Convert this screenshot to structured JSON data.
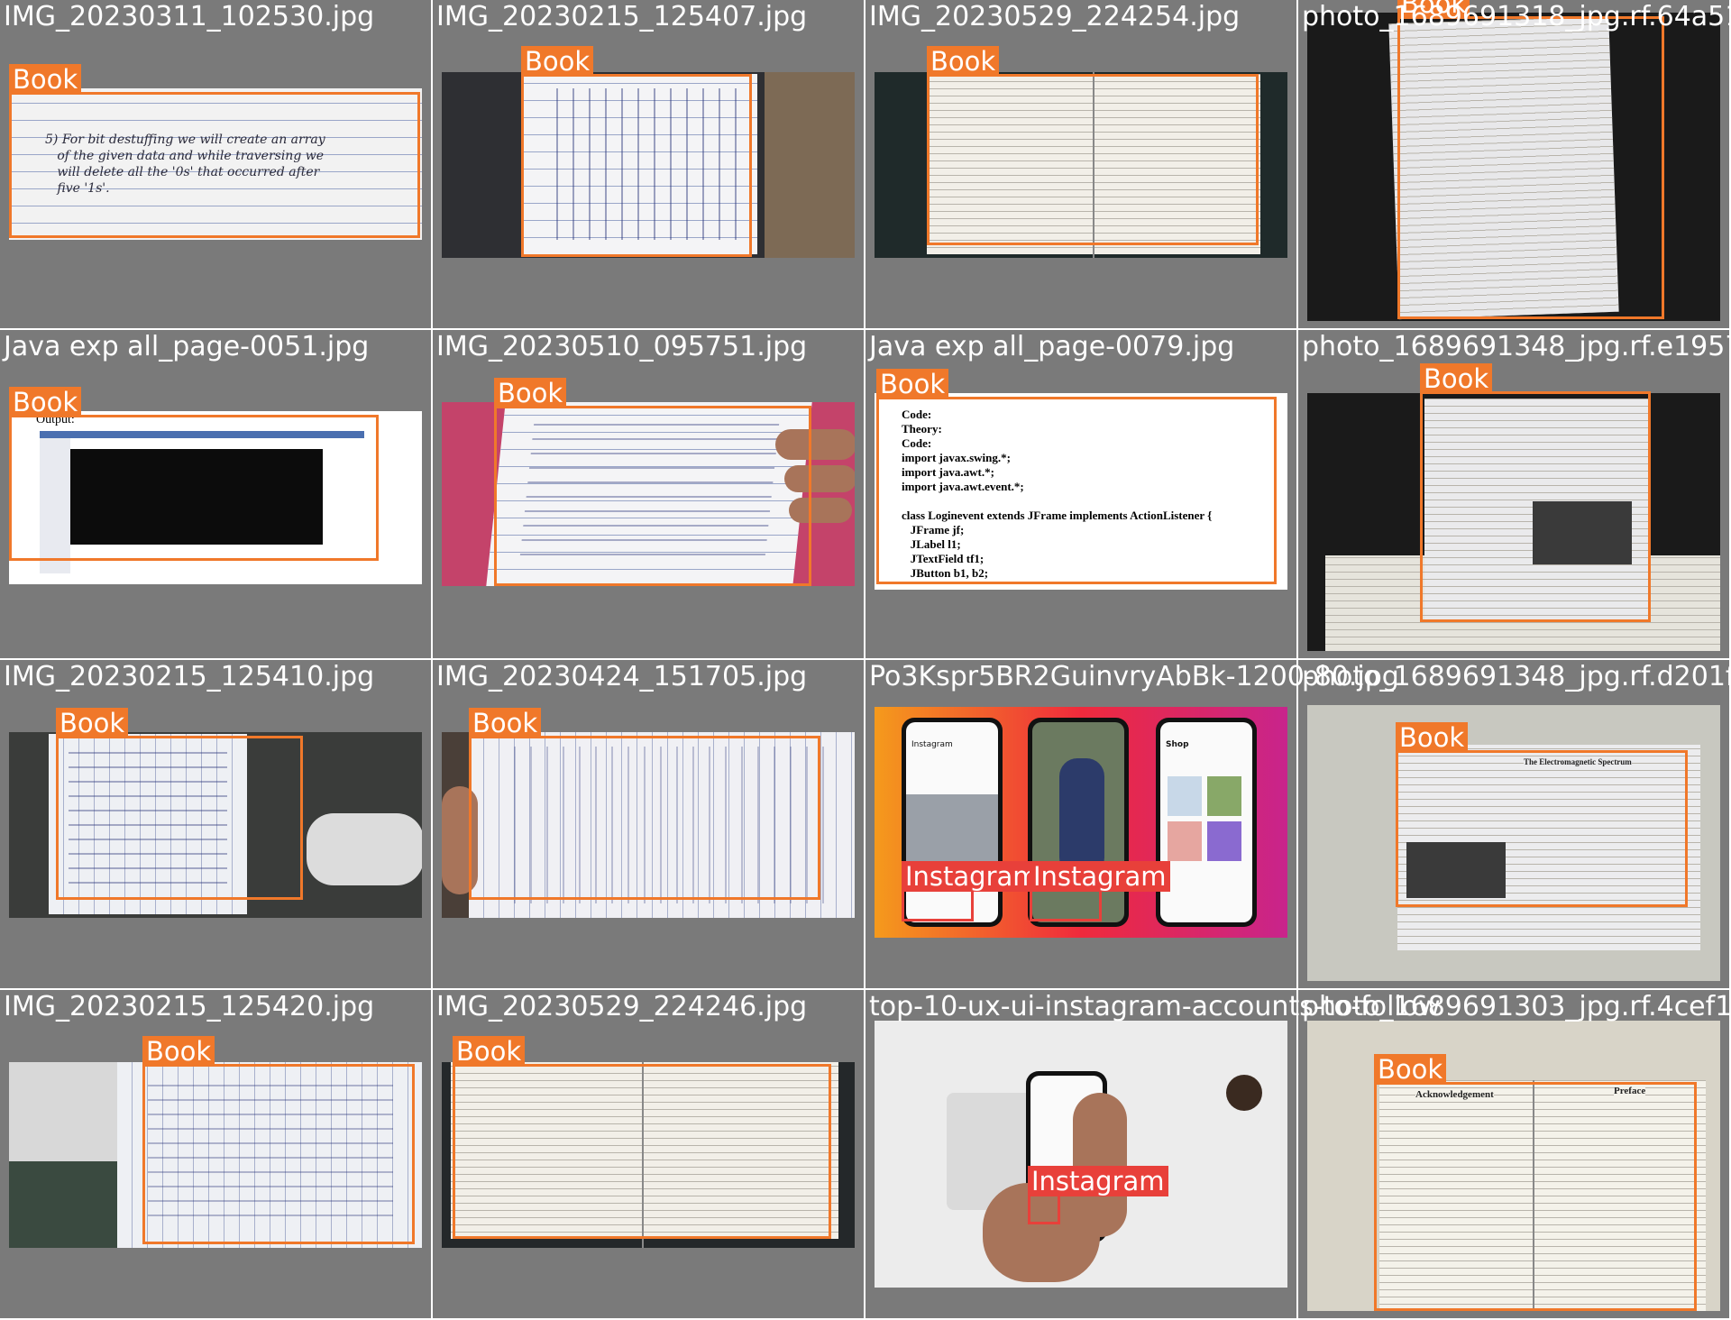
{
  "colors": {
    "book_box": "#f0782a",
    "instagram_box": "#e8403a",
    "tile_bg": "#7a7a7a"
  },
  "tiles": [
    {
      "file": "IMG_20230311_102530.jpg",
      "labels": [
        "Book"
      ],
      "handwriting": "5) For bit destuffing we will create an array\n   of the given data and while traversing we\n   will delete all the '0s' that occurred after\n   five '1s'."
    },
    {
      "file": "IMG_20230215_125407.jpg",
      "labels": [
        "Book"
      ]
    },
    {
      "file": "IMG_20230529_224254.jpg",
      "labels": [
        "Book"
      ]
    },
    {
      "file": "photo_1689691318_jpg.rf.64a51",
      "labels": [
        "Book"
      ]
    },
    {
      "file": "Java exp all_page-0051.jpg",
      "labels": [
        "Book"
      ],
      "caption": "Output:"
    },
    {
      "file": "IMG_20230510_095751.jpg",
      "labels": [
        "Book"
      ]
    },
    {
      "file": "Java exp all_page-0079.jpg",
      "labels": [
        "Book"
      ],
      "code": "Code:\nTheory:\nCode:\nimport javax.swing.*;\nimport java.awt.*;\nimport java.awt.event.*;\n\nclass Loginevent extends JFrame implements ActionListener {\n   JFrame jf;\n   JLabel l1;\n   JTextField tf1;\n   JButton b1, b2;"
    },
    {
      "file": "photo_1689691348_jpg.rf.e1957",
      "labels": [
        "Book"
      ]
    },
    {
      "file": "IMG_20230215_125410.jpg",
      "labels": [
        "Book"
      ]
    },
    {
      "file": "IMG_20230424_151705.jpg",
      "labels": [
        "Book"
      ]
    },
    {
      "file": "Po3Kspr5BR2GuinvryAbBk-1200-80.jpg",
      "labels": [
        "Instagram",
        "Instagram"
      ],
      "app_title": "Instagram",
      "shop_title": "Shop"
    },
    {
      "file": "photo_1689691348_jpg.rf.d201f4",
      "labels": [
        "Book"
      ],
      "page_heading": "The Electromagnetic Spectrum"
    },
    {
      "file": "IMG_20230215_125420.jpg",
      "labels": [
        "Book"
      ]
    },
    {
      "file": "IMG_20230529_224246.jpg",
      "labels": [
        "Book"
      ]
    },
    {
      "file": "top-10-ux-ui-instagram-accounts-to-follow",
      "labels": [
        "Instagram"
      ]
    },
    {
      "file": "photo_1689691303_jpg.rf.4cef1b",
      "labels": [
        "Book"
      ],
      "left_heading": "Acknowledgement",
      "right_heading": "Preface"
    }
  ]
}
